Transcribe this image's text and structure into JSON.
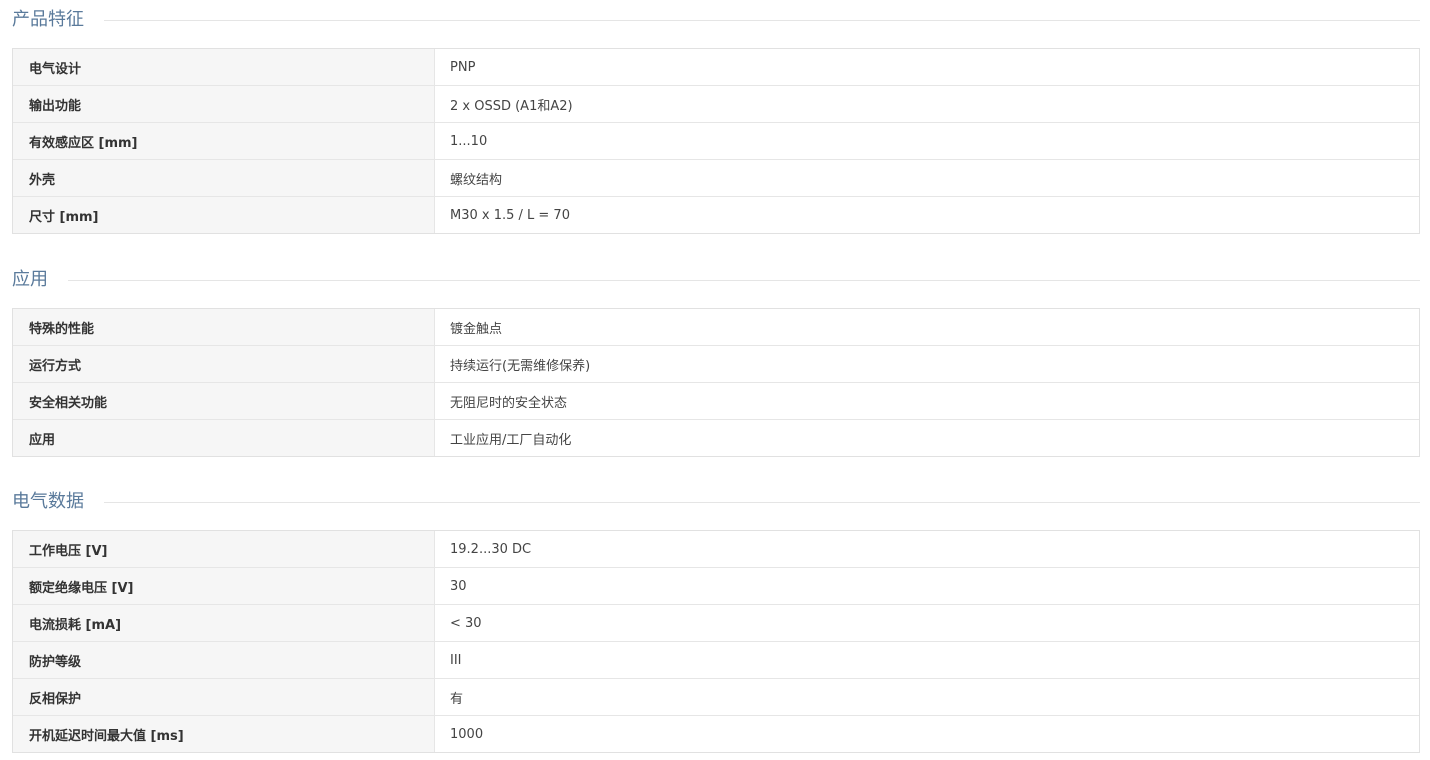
{
  "sections": [
    {
      "title": "产品特征",
      "rows": [
        {
          "label": "电气设计",
          "value": "PNP"
        },
        {
          "label": "输出功能",
          "value": "2 x OSSD (A1和A2)"
        },
        {
          "label": "有效感应区 [mm]",
          "value": "1...10"
        },
        {
          "label": "外壳",
          "value": "螺纹结构"
        },
        {
          "label": "尺寸 [mm]",
          "value": "M30 x 1.5 / L = 70"
        }
      ]
    },
    {
      "title": "应用",
      "rows": [
        {
          "label": "特殊的性能",
          "value": "镀金触点"
        },
        {
          "label": "运行方式",
          "value": "持续运行(无需维修保养)"
        },
        {
          "label": "安全相关功能",
          "value": "无阻尼时的安全状态"
        },
        {
          "label": "应用",
          "value": "工业应用/工厂自动化"
        }
      ]
    },
    {
      "title": "电气数据",
      "rows": [
        {
          "label": "工作电压 [V]",
          "value": "19.2...30 DC"
        },
        {
          "label": "额定绝缘电压 [V]",
          "value": "30"
        },
        {
          "label": "电流损耗 [mA]",
          "value": "< 30"
        },
        {
          "label": "防护等级",
          "value": "III"
        },
        {
          "label": "反相保护",
          "value": "有"
        },
        {
          "label": "开机延迟时间最大值 [ms]",
          "value": "1000"
        }
      ]
    }
  ]
}
